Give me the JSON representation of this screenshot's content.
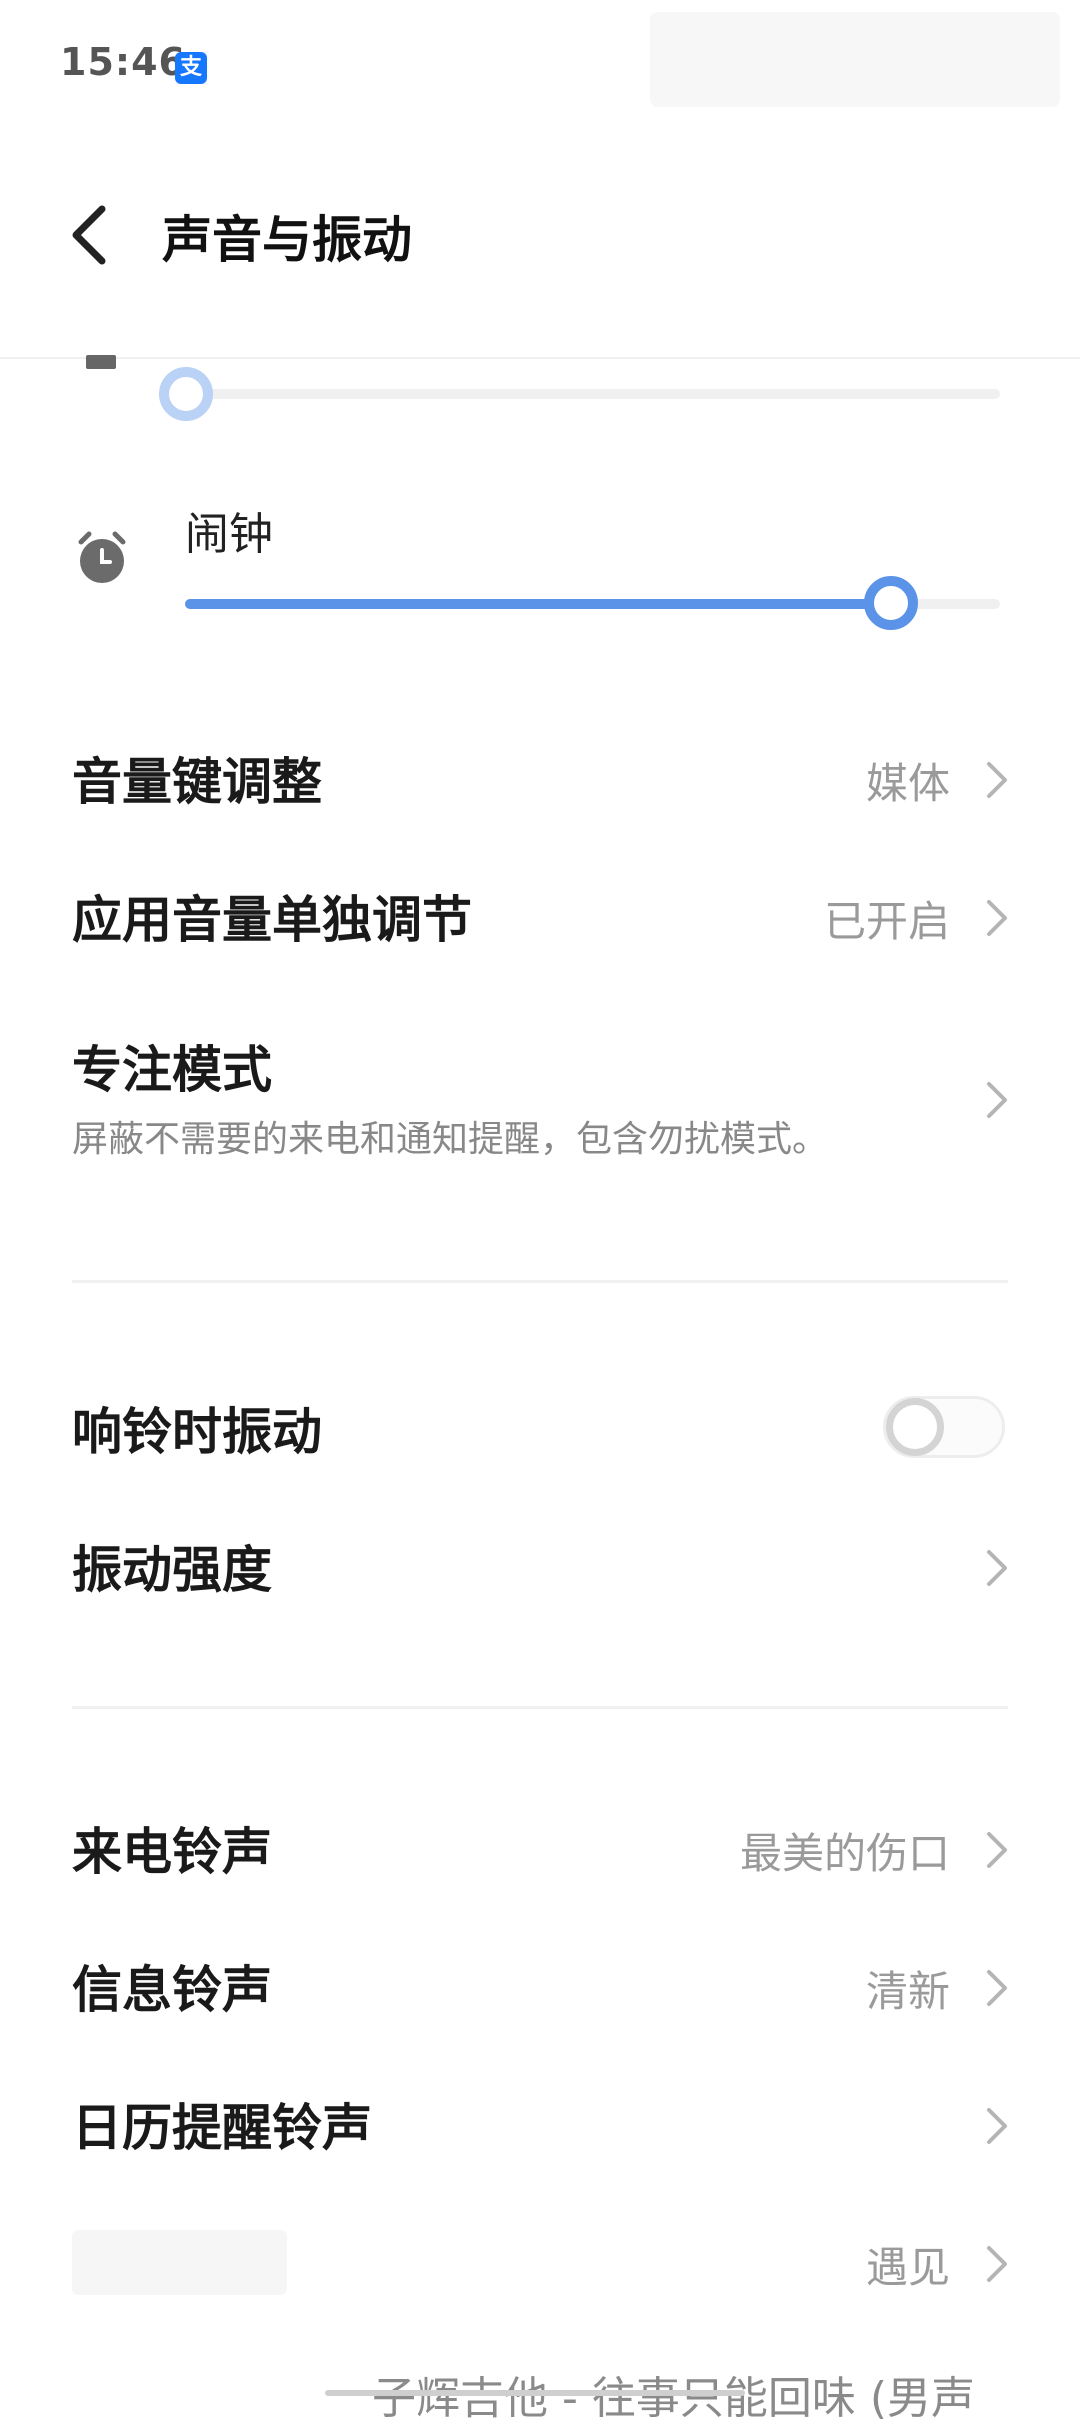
{
  "status_bar": {
    "time": "15:46",
    "badge_char": "支"
  },
  "header": {
    "title": "声音与振动"
  },
  "sliders": {
    "top_partial": {
      "level": 0.0
    },
    "alarm": {
      "label": "闹钟",
      "level": 0.87
    }
  },
  "rows": {
    "volume_keys": {
      "title": "音量键调整",
      "value": "媒体"
    },
    "app_volume": {
      "title": "应用音量单独调节",
      "value": "已开启"
    },
    "focus_mode": {
      "title": "专注模式",
      "subtitle": "屏蔽不需要的来电和通知提醒，包含勿扰模式。"
    },
    "vibrate_on_ring": {
      "title": "响铃时振动",
      "enabled": false
    },
    "vibration_strength": {
      "title": "振动强度"
    },
    "ringtone": {
      "title": "来电铃声",
      "value": "最美的伤口"
    },
    "message_tone": {
      "title": "信息铃声",
      "value": "清新"
    },
    "calendar_tone": {
      "title": "日历提醒铃声"
    },
    "blurred_row": {
      "value": "遇见"
    }
  },
  "bottom": {
    "now_playing": "子辉吉他 - 往事只能回味 (男声"
  },
  "colors": {
    "accent": "#5a93e8",
    "value_gray": "#9a9a9a"
  }
}
